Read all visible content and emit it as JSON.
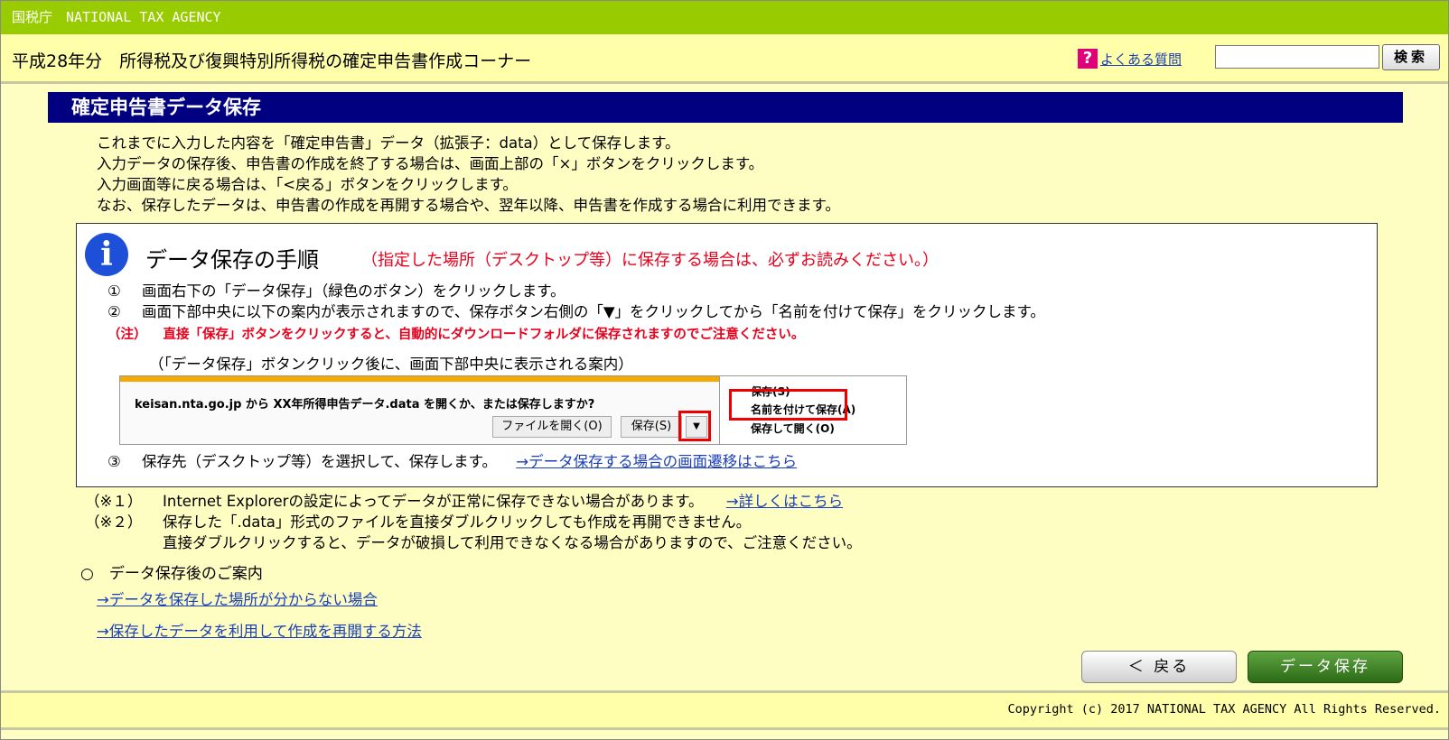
{
  "header": {
    "agency": "国税庁　NATIONAL TAX AGENCY",
    "app_title": "平成28年分　所得税及び復興特別所得税の確定申告書作成コーナー",
    "faq_icon": "?",
    "faq_label": "よくある質問",
    "search_value": "",
    "search_button": "検索"
  },
  "section": {
    "title": "確定申告書データ保存"
  },
  "intro": [
    "これまでに入力した内容を「確定申告書」データ（拡張子：data）として保存します。",
    "入力データの保存後、申告書の作成を終了する場合は、画面上部の「×」ボタンをクリックします。",
    "入力画面等に戻る場合は、「<戻る」ボタンをクリックします。",
    "なお、保存したデータは、申告書の作成を再開する場合や、翌年以降、申告書を作成する場合に利用できます。"
  ],
  "info": {
    "icon": "i",
    "title": "データ保存の手順",
    "note": "（指定した場所（デスクトップ等）に保存する場合は、必ずお読みください。）",
    "steps": [
      {
        "num": "①",
        "text": "画面右下の「データ保存」（緑色のボタン）をクリックします。"
      },
      {
        "num": "②",
        "text": "画面下部中央に以下の案内が表示されますので、保存ボタン右側の「▼」をクリックしてから「名前を付けて保存」をクリックします。"
      },
      {
        "num": "③",
        "text": "保存先（デスクトップ等）を選択して、保存します。",
        "link": "→データ保存する場合の画面遷移はこちら"
      }
    ],
    "warning_tag": "（注）",
    "warning": "直接「保存」ボタンをクリックすると、自動的にダウンロードフォルダに保存されますのでご注意ください。",
    "caption": "（「データ保存」ボタンクリック後に、画面下部中央に表示される案内）",
    "ie": {
      "question": "keisan.nta.go.jp から XX年所得申告データ.data を開くか、または保存しますか?",
      "open_button": "ファイルを開く(O)",
      "save_button": "保存(S)",
      "dropdown": "▼",
      "menu": [
        "保存(S)",
        "名前を付けて保存(A)",
        "保存して開く(O)"
      ]
    }
  },
  "notes": [
    {
      "tag": "（※１）",
      "text": "Internet Explorerの設定によってデータが正常に保存できない場合があります。",
      "link": "→詳しくはこちら"
    },
    {
      "tag": "（※２）",
      "text": "保存した「.data」形式のファイルを直接ダブルクリックしても作成を再開できません。"
    },
    {
      "tag": "",
      "text": "直接ダブルクリックすると、データが破損して利用できなくなる場合がありますので、ご注意ください。"
    }
  ],
  "after": {
    "title": "○　データ保存後のご案内",
    "links": [
      "→データを保存した場所が分からない場合",
      "→保存したデータを利用して作成を再開する方法"
    ]
  },
  "buttons": {
    "back": "＜ 戻る",
    "save": "データ保存"
  },
  "footer": {
    "copyright": "Copyright (c) 2017 NATIONAL TAX AGENCY All Rights Reserved."
  }
}
